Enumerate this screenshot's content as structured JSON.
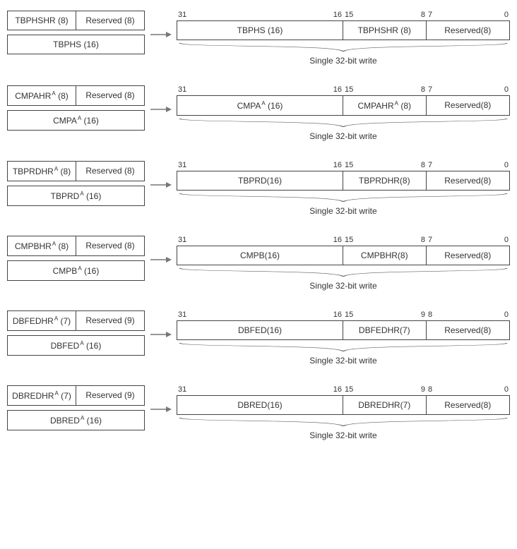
{
  "caption": "Single 32-bit write",
  "rows": [
    {
      "leftA": "TBPHSHR (8)",
      "leftA_sup": false,
      "leftB": "Reserved (8)",
      "leftC": "TBPHS (16)",
      "leftC_sup": false,
      "hi": "TBPHS (16)",
      "md": "TBPHSHR (8)",
      "lo": "Reserved(8)",
      "b31": "31",
      "b16": "16",
      "b15": "15",
      "bm": "8",
      "bm1": "7",
      "b0": "0"
    },
    {
      "leftA": "CMPAHR",
      "leftA_sup": true,
      "leftA_tail": " (8)",
      "leftB": "Reserved (8)",
      "leftC": "CMPA",
      "leftC_sup": true,
      "leftC_tail": " (16)",
      "hi": "CMPA",
      "hi_sup": true,
      "hi_tail": " (16)",
      "md": "CMPAHR",
      "md_sup": true,
      "md_tail": " (8)",
      "lo": "Reserved(8)",
      "b31": "31",
      "b16": "16",
      "b15": "15",
      "bm": "8",
      "bm1": "7",
      "b0": "0"
    },
    {
      "leftA": "TBPRDHR",
      "leftA_sup": true,
      "leftA_tail": " (8)",
      "leftB": "Reserved (8)",
      "leftC": "TBPRD",
      "leftC_sup": true,
      "leftC_tail": " (16)",
      "hi": "TBPRD(16)",
      "md": "TBPRDHR(8)",
      "lo": "Reserved(8)",
      "b31": "31",
      "b16": "16",
      "b15": "15",
      "bm": "8",
      "bm1": "7",
      "b0": "0"
    },
    {
      "leftA": "CMPBHR",
      "leftA_sup": true,
      "leftA_tail": " (8)",
      "leftB": "Reserved (8)",
      "leftC": "CMPB",
      "leftC_sup": true,
      "leftC_tail": " (16)",
      "hi": "CMPB(16)",
      "md": "CMPBHR(8)",
      "lo": "Reserved(8)",
      "b31": "31",
      "b16": "16",
      "b15": "15",
      "bm": "8",
      "bm1": "7",
      "b0": "0"
    },
    {
      "leftA": "DBFEDHR",
      "leftA_sup": true,
      "leftA_tail": " (7)",
      "leftB": "Reserved (9)",
      "leftC": "DBFED",
      "leftC_sup": true,
      "leftC_tail": " (16)",
      "hi": "DBFED(16)",
      "md": "DBFEDHR(7)",
      "lo": "Reserved(8)",
      "b31": "31",
      "b16": "16",
      "b15": "15",
      "bm": "9",
      "bm1": "8",
      "b0": "0"
    },
    {
      "leftA": "DBREDHR",
      "leftA_sup": true,
      "leftA_tail": " (7)",
      "leftB": "Reserved (9)",
      "leftC": "DBRED",
      "leftC_sup": true,
      "leftC_tail": " (16)",
      "hi": "DBRED(16)",
      "md": "DBREDHR(7)",
      "lo": "Reserved(8)",
      "b31": "31",
      "b16": "16",
      "b15": "15",
      "bm": "9",
      "bm1": "8",
      "b0": "0"
    }
  ]
}
